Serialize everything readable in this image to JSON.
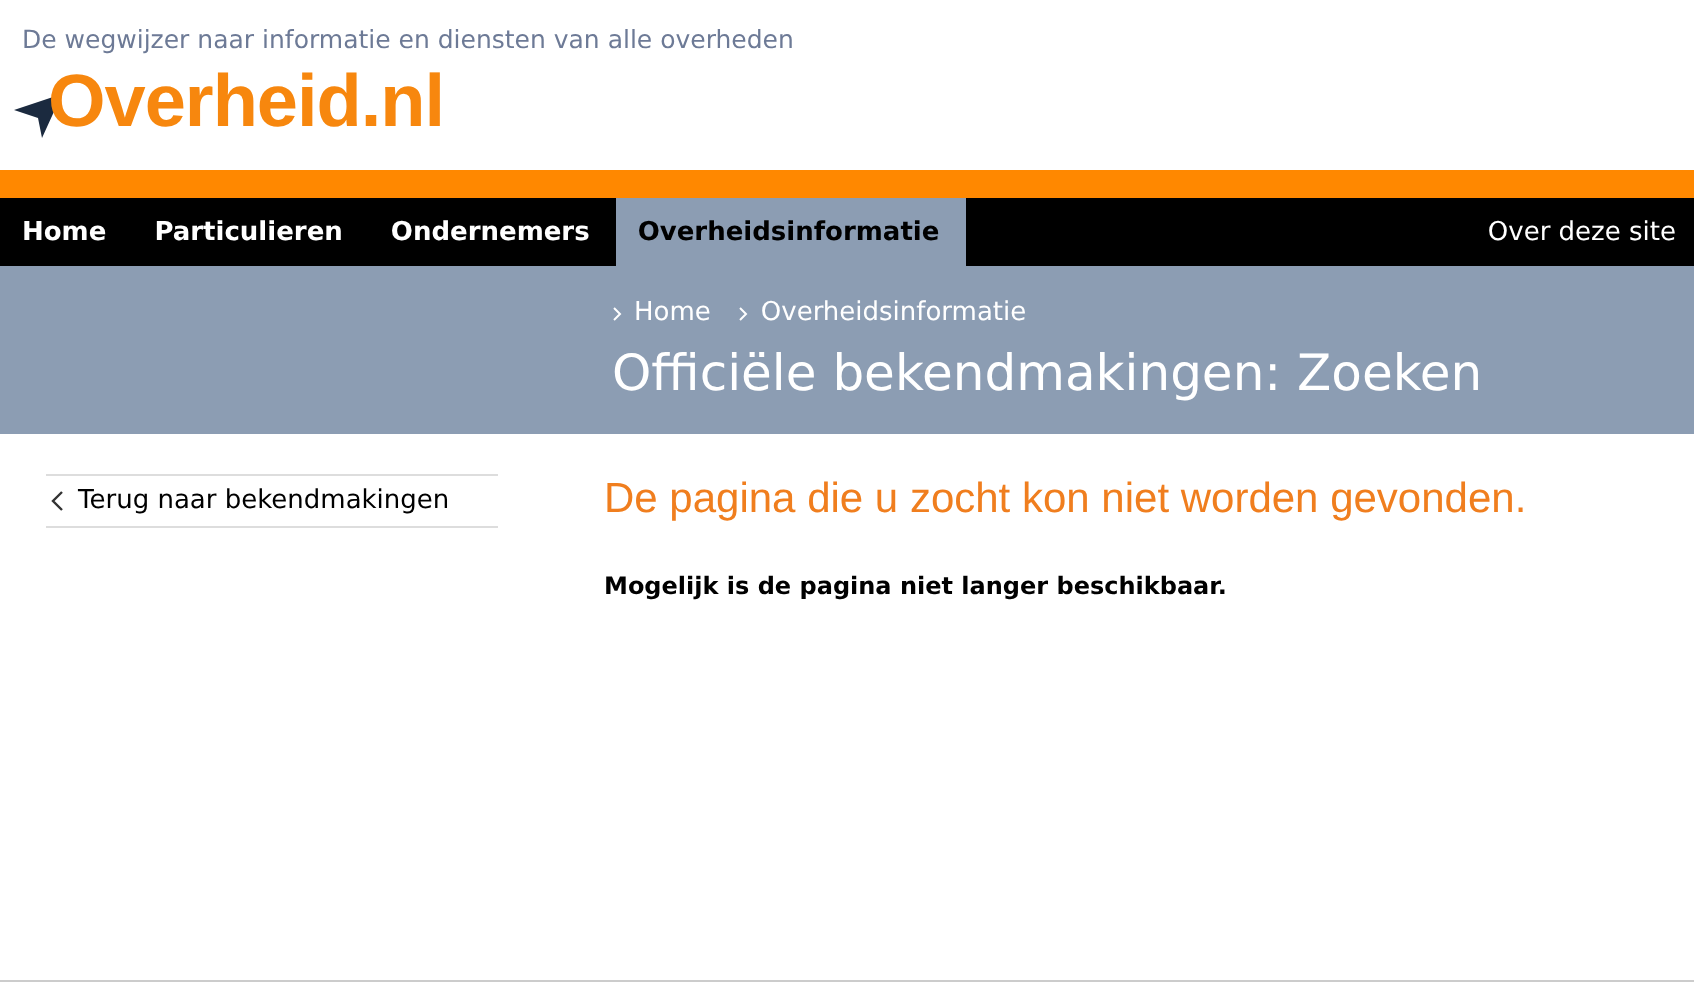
{
  "header": {
    "tagline": "De wegwijzer naar informatie en diensten van alle overheden",
    "logo": "Overheid.nl"
  },
  "nav": {
    "items": [
      {
        "label": "Home",
        "selected": false
      },
      {
        "label": "Particulieren",
        "selected": false
      },
      {
        "label": "Ondernemers",
        "selected": false
      },
      {
        "label": "Overheidsinformatie",
        "selected": true
      }
    ],
    "right_link": "Over deze site"
  },
  "breadcrumb": [
    "Home",
    "Overheidsinformatie"
  ],
  "page_title": "Officiële bekendmakingen: Zoeken",
  "sidebar": {
    "back_link": "Terug naar bekendmakingen"
  },
  "content": {
    "heading": "De pagina die u zocht kon niet worden gevonden.",
    "message": "Mogelijk is de pagina niet langer beschikbaar."
  }
}
